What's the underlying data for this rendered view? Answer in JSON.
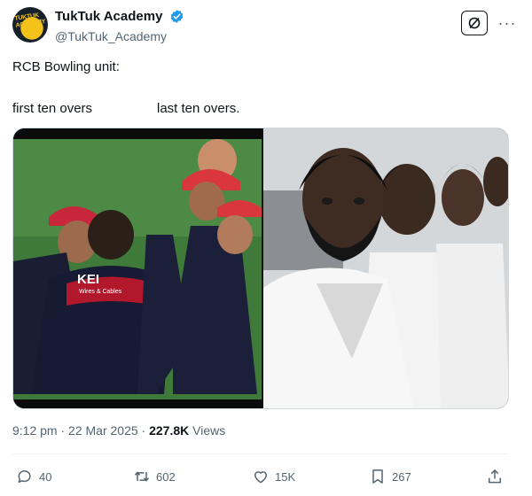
{
  "account": {
    "display_name": "TukTuk Academy",
    "handle": "@TukTuk_Academy",
    "avatar_text": "TUKTUK ACADEMY",
    "verified_color": "#1d9bf0"
  },
  "post": {
    "text_line1": "RCB Bowling unit:",
    "text_left": "first ten overs",
    "text_right": "last ten overs."
  },
  "media": {
    "left_image_icon": "cricket-team-huddle-image",
    "left_jersey_text": "KEI",
    "left_jersey_sub": "Wires & Cables",
    "right_image_icon": "bowlers-group-photo-image"
  },
  "meta": {
    "time": "9:12 pm",
    "separator": "·",
    "date": "22 Mar 2025",
    "separator2": "·",
    "views_count": "227.8K",
    "views_label": "Views"
  },
  "actions": {
    "replies": "40",
    "reposts": "602",
    "likes": "15K",
    "bookmarks": "267"
  },
  "icons": {
    "grok": "grok-icon",
    "more": "more-icon",
    "reply": "reply-icon",
    "repost": "repost-icon",
    "like": "heart-icon",
    "bookmark": "bookmark-icon",
    "share": "share-icon"
  }
}
